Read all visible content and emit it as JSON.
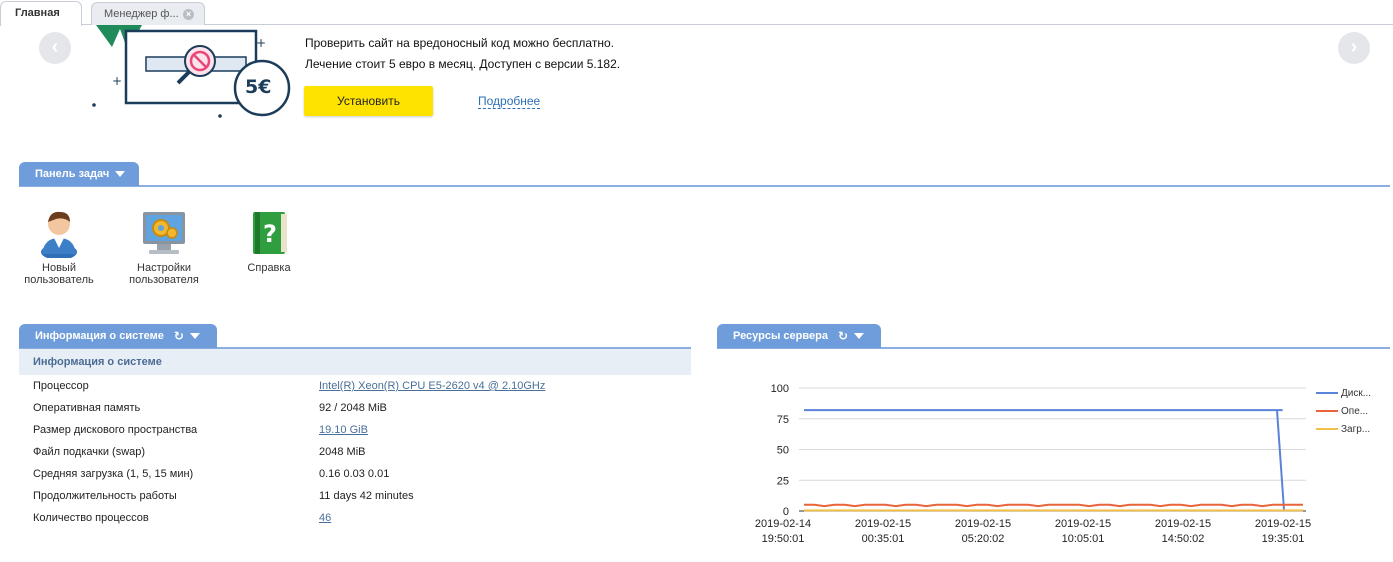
{
  "tabs": [
    {
      "label": "Главная",
      "active": true
    },
    {
      "label": "Менеджер ф...",
      "active": false
    }
  ],
  "banner": {
    "line1": "Проверить сайт на вредоносный код можно бесплатно.",
    "line2": "Лечение стоит 5 евро в месяц. Доступен с версии 5.182.",
    "price_badge": "5€",
    "install_label": "Установить",
    "more_label": "Подробнее"
  },
  "taskbar": {
    "title": "Панель задач",
    "items": [
      {
        "label": "Новый пользователь",
        "icon": "user-add-icon"
      },
      {
        "label": "Настройки пользователя",
        "icon": "monitor-settings-icon"
      },
      {
        "label": "Справка",
        "icon": "help-book-icon"
      }
    ]
  },
  "sysinfo": {
    "title": "Информация о системе",
    "subtitle": "Информация о системе",
    "rows": [
      {
        "label": "Процессор",
        "value": "Intel(R) Xeon(R) CPU E5-2620 v4 @ 2.10GHz",
        "link": true
      },
      {
        "label": "Оперативная память",
        "value": "92 / 2048 MiB",
        "link": false
      },
      {
        "label": "Размер дискового пространства",
        "value": "19.10 GiB",
        "link": true
      },
      {
        "label": "Файл подкачки (swap)",
        "value": "2048 MiB",
        "link": false
      },
      {
        "label": "Средняя загрузка (1, 5, 15 мин)",
        "value": "0.16 0.03 0.01",
        "link": false
      },
      {
        "label": "Продолжительность работы",
        "value": "11 days 42 minutes",
        "link": false
      },
      {
        "label": "Количество процессов",
        "value": "46",
        "link": true
      }
    ]
  },
  "resources": {
    "title": "Ресурсы сервера"
  },
  "chart_data": {
    "type": "line",
    "ylim": [
      0,
      100
    ],
    "yticks": [
      "100",
      "75",
      "50",
      "25",
      "0"
    ],
    "x_labels": [
      {
        "date": "2019-02-14",
        "time": "19:50:01"
      },
      {
        "date": "2019-02-15",
        "time": "00:35:01"
      },
      {
        "date": "2019-02-15",
        "time": "05:20:02"
      },
      {
        "date": "2019-02-15",
        "time": "10:05:01"
      },
      {
        "date": "2019-02-15",
        "time": "14:50:02"
      },
      {
        "date": "2019-02-15",
        "time": "19:35:01"
      }
    ],
    "series": [
      {
        "name": "Диск...",
        "color": "#5b83d9",
        "values": [
          82,
          82,
          82,
          82,
          82,
          82,
          82,
          82,
          82,
          82,
          82,
          82,
          82,
          82,
          82,
          82,
          82,
          82,
          82,
          82,
          82,
          82,
          82,
          82,
          82,
          82,
          82,
          82,
          82,
          82,
          82,
          82,
          82,
          82,
          82,
          82,
          82,
          82,
          82,
          82,
          82,
          82,
          82,
          82,
          82,
          82,
          82,
          82,
          82,
          1
        ]
      },
      {
        "name": "Опе...",
        "color": "#e8643a",
        "values": [
          5,
          5,
          4,
          5,
          5,
          4,
          5,
          5,
          5,
          4,
          5,
          5,
          4,
          5,
          5,
          5,
          4,
          5,
          5,
          4,
          5,
          5,
          5,
          4,
          5,
          5,
          5,
          5,
          4,
          5,
          5,
          4,
          5,
          5,
          5,
          4,
          5,
          5,
          4,
          5,
          5,
          5,
          4,
          5,
          5,
          4,
          5,
          5,
          5,
          5
        ]
      },
      {
        "name": "Загр...",
        "color": "#f2c04a",
        "values": [
          0.5,
          0.5,
          0.5,
          0.5,
          0.5,
          0.5,
          0.5,
          0.5,
          0.5,
          0.5,
          0.5,
          0.5,
          0.5,
          0.5,
          0.5,
          0.5,
          0.5,
          0.5,
          0.5,
          0.5,
          0.5,
          0.5,
          0.5,
          0.5,
          0.5,
          0.5,
          0.5,
          0.5,
          0.5,
          0.5,
          0.5,
          0.5,
          0.5,
          0.5,
          0.5,
          0.5,
          0.5,
          0.5,
          0.5,
          0.5,
          0.5,
          0.5,
          0.5,
          0.5,
          0.5,
          0.5,
          0.5,
          0.5,
          0.5,
          0.5
        ]
      }
    ]
  }
}
